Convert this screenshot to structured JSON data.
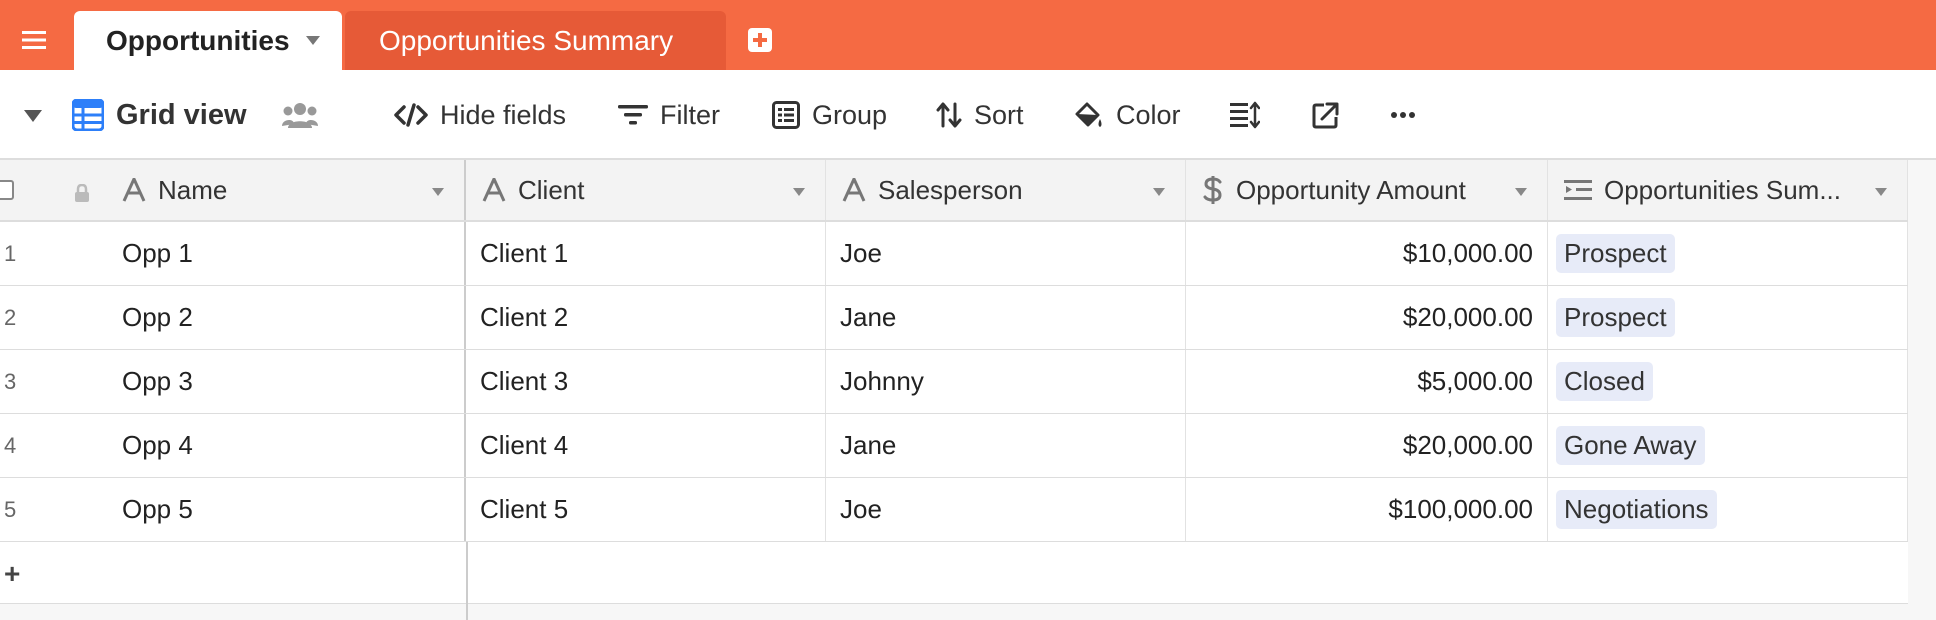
{
  "tabs": [
    {
      "label": "Opportunities",
      "active": true
    },
    {
      "label": "Opportunities Summary",
      "active": false
    }
  ],
  "toolbar": {
    "view_name": "Grid view",
    "hide_fields": "Hide fields",
    "filter": "Filter",
    "group": "Group",
    "sort": "Sort",
    "color": "Color"
  },
  "columns": [
    {
      "name": "Name",
      "icon": "text-icon"
    },
    {
      "name": "Client",
      "icon": "text-icon"
    },
    {
      "name": "Salesperson",
      "icon": "text-icon"
    },
    {
      "name": "Opportunity Amount",
      "icon": "currency-icon"
    },
    {
      "name": "Opportunities Sum...",
      "icon": "lookup-icon"
    }
  ],
  "rows": [
    {
      "num": "1",
      "name": "Opp 1",
      "client": "Client 1",
      "salesperson": "Joe",
      "amount": "$10,000.00",
      "summary": "Prospect"
    },
    {
      "num": "2",
      "name": "Opp 2",
      "client": "Client 2",
      "salesperson": "Jane",
      "amount": "$20,000.00",
      "summary": "Prospect"
    },
    {
      "num": "3",
      "name": "Opp 3",
      "client": "Client 3",
      "salesperson": "Johnny",
      "amount": "$5,000.00",
      "summary": "Closed"
    },
    {
      "num": "4",
      "name": "Opp 4",
      "client": "Client 4",
      "salesperson": "Jane",
      "amount": "$20,000.00",
      "summary": "Gone Away"
    },
    {
      "num": "5",
      "name": "Opp 5",
      "client": "Client 5",
      "salesperson": "Joe",
      "amount": "$100,000.00",
      "summary": "Negotiations"
    }
  ],
  "add_row_label": "+",
  "colors": {
    "brand": "#f56a43",
    "inactive_tab": "#e65a37",
    "pill_bg": "#e7ebf8",
    "view_icon": "#2d7ff9"
  }
}
